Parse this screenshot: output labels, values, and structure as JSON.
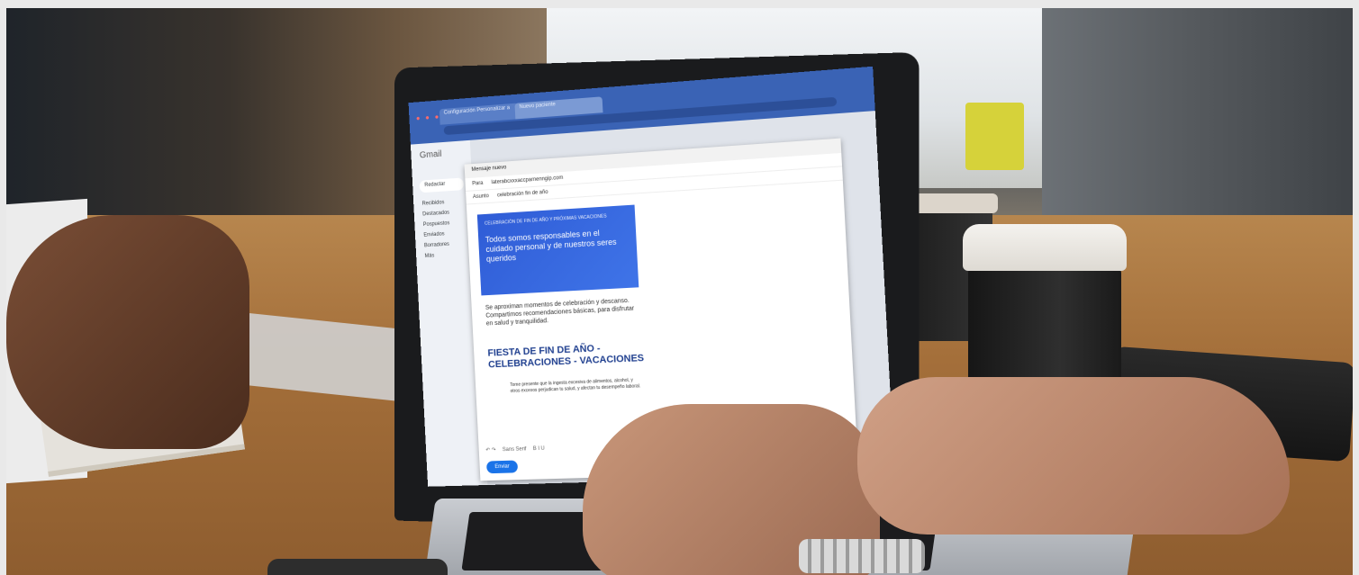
{
  "scene": {
    "description_tags": [
      "laptop-icon",
      "coffee-cup-icon",
      "hands-icon",
      "wallet-icon",
      "pen-icon"
    ]
  },
  "browser": {
    "tab1_label": "Configuración Personalizar a",
    "tab2_label": "Nuevo paciente"
  },
  "gmail": {
    "logo": "Gmail",
    "compose_label": "Redactar",
    "sidebar": [
      "Recibidos",
      "Destacados",
      "Pospuestos",
      "Enviados",
      "Borradores",
      "Más"
    ]
  },
  "compose": {
    "window_title": "Mensaje nuevo",
    "to_label": "Para",
    "to_value": "laterabcxxxaccparnenngip.com",
    "subject_label": "Asunto",
    "subject_value": "celebración fin de año",
    "banner_kicker": "CELEBRACIÓN DE FIN DE AÑO Y PRÓXIMAS VACACIONES",
    "banner_headline": "Todos somos responsables en el cuidado personal y de nuestros seres queridos",
    "body_text": "Se aproximan momentos de celebración y descanso. Compartimos recomendaciones básicas, para disfrutar en salud y tranquilidad.",
    "fiesta_title": "FIESTA DE FIN DE AÑO - CELEBRACIONES - VACACIONES",
    "small_text": "Tome presente que la ingesta excesiva de alimentos, alcohol, y otros excesos perjudican tu salud, y afectan tu desempeño laboral.",
    "font_label": "Sans Serif",
    "send_label": "Enviar"
  }
}
